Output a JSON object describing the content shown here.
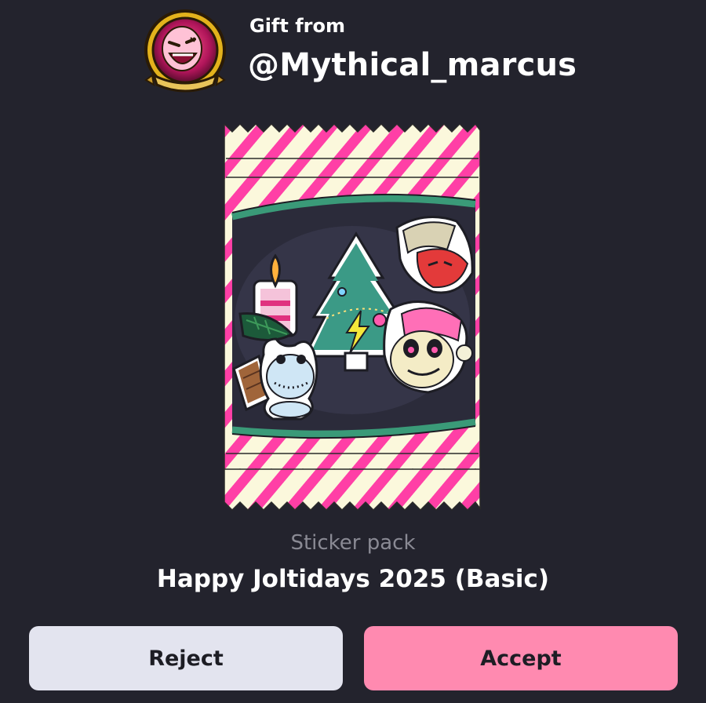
{
  "gift": {
    "label": "Gift from",
    "username": "@Mythical_marcus"
  },
  "item": {
    "type": "Sticker pack",
    "name": "Happy Joltidays 2025 (Basic)"
  },
  "actions": {
    "reject_label": "Reject",
    "accept_label": "Accept"
  },
  "colors": {
    "background": "#23232d",
    "accept": "#ff8ab0",
    "reject": "#e3e4ef",
    "pack_stripe": "#ff3fa6",
    "pack_paper": "#fbf8dc",
    "window_border": "#3a9a78"
  },
  "icons": {
    "avatar": "sender-avatar",
    "stickers": [
      "candle-sticker",
      "christmas-tree-sticker",
      "santa-hat-head-sticker",
      "panda-santa-sticker",
      "frog-snowman-sticker",
      "wooden-sign-sticker",
      "pine-branch-sticker"
    ]
  }
}
